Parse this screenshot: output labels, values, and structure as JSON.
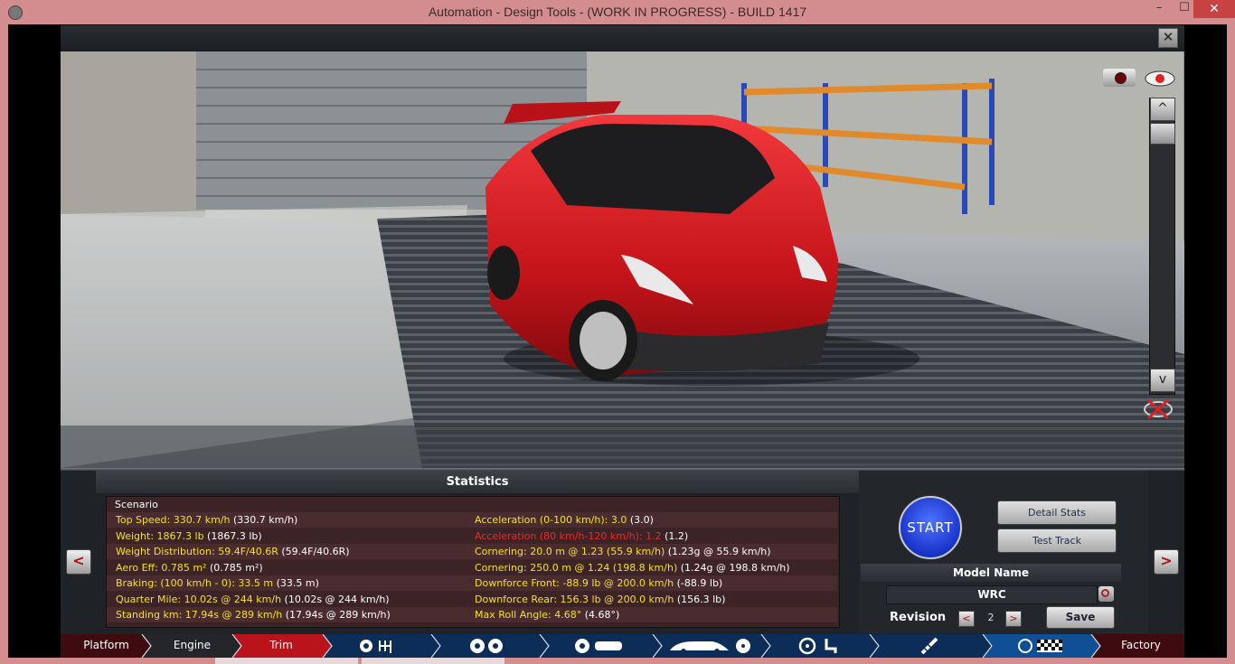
{
  "window": {
    "title": "Automation - Design Tools - (WORK IN PROGRESS) - BUILD 1417",
    "minimize": "–",
    "maximize": "☐",
    "close": "✕"
  },
  "viewport": {
    "close_label": "✕",
    "scroll_up": "^",
    "scroll_down": "v"
  },
  "statistics": {
    "title": "Statistics",
    "scenario": "Scenario",
    "left": [
      {
        "label": "Top Speed: 330.7 km/h",
        "alt": " (330.7 km/h)",
        "color": "y"
      },
      {
        "label": "Weight: 1867.3 lb",
        "alt": " (1867.3 lb)",
        "color": "y"
      },
      {
        "label": "Weight Distribution: 59.4F/40.6R",
        "alt": " (59.4F/40.6R)",
        "color": "y"
      },
      {
        "label": "Aero Eff: 0.785 m²",
        "alt": " (0.785 m²)",
        "color": "y"
      },
      {
        "label": "Braking: (100 km/h - 0): 33.5 m",
        "alt": " (33.5 m)",
        "color": "y"
      },
      {
        "label": "Quarter Mile: 10.02s @ 244 km/h",
        "alt": " (10.02s @ 244 km/h)",
        "color": "y"
      },
      {
        "label": "Standing km: 17.94s @ 289 km/h",
        "alt": " (17.94s @ 289 km/h)",
        "color": "y"
      }
    ],
    "right": [
      {
        "label": "Acceleration (0-100 km/h): 3.0",
        "alt": " (3.0)",
        "color": "y"
      },
      {
        "label": "Acceleration (80 km/h-120 km/h): 1.2",
        "alt": " (1.2)",
        "color": "r"
      },
      {
        "label": "Cornering: 20.0 m @ 1.23 (55.9 km/h)",
        "alt": " (1.23g @ 55.9 km/h)",
        "color": "y"
      },
      {
        "label": "Cornering: 250.0 m @ 1.24 (198.8 km/h)",
        "alt": " (1.24g @ 198.8 km/h)",
        "color": "y"
      },
      {
        "label": "Downforce Front: -88.9 lb @ 200.0 km/h",
        "alt": " (-88.9 lb)",
        "color": "y"
      },
      {
        "label": "Downforce Rear: 156.3 lb @ 200.0 km/h",
        "alt": " (156.3 lb)",
        "color": "y"
      },
      {
        "label": "Max Roll Angle: 4.68°",
        "alt": " (4.68°)",
        "color": "y"
      }
    ],
    "prev": "<",
    "next": ">"
  },
  "controls": {
    "start": "START",
    "detail_stats": "Detail Stats",
    "test_track": "Test Track",
    "model_name_label": "Model Name",
    "model_name": "WRC",
    "revision_label": "Revision",
    "revision_value": "2",
    "rev_prev": "<",
    "rev_next": ">",
    "save": "Save"
  },
  "nav": {
    "platform": "Platform",
    "engine": "Engine",
    "trim": "Trim",
    "factory": "Factory"
  },
  "colors": {
    "accent_red": "#e01c2a",
    "stat_yellow": "#f4e12a",
    "stat_red": "#ea2b2b",
    "start_blue": "#1933c9"
  }
}
